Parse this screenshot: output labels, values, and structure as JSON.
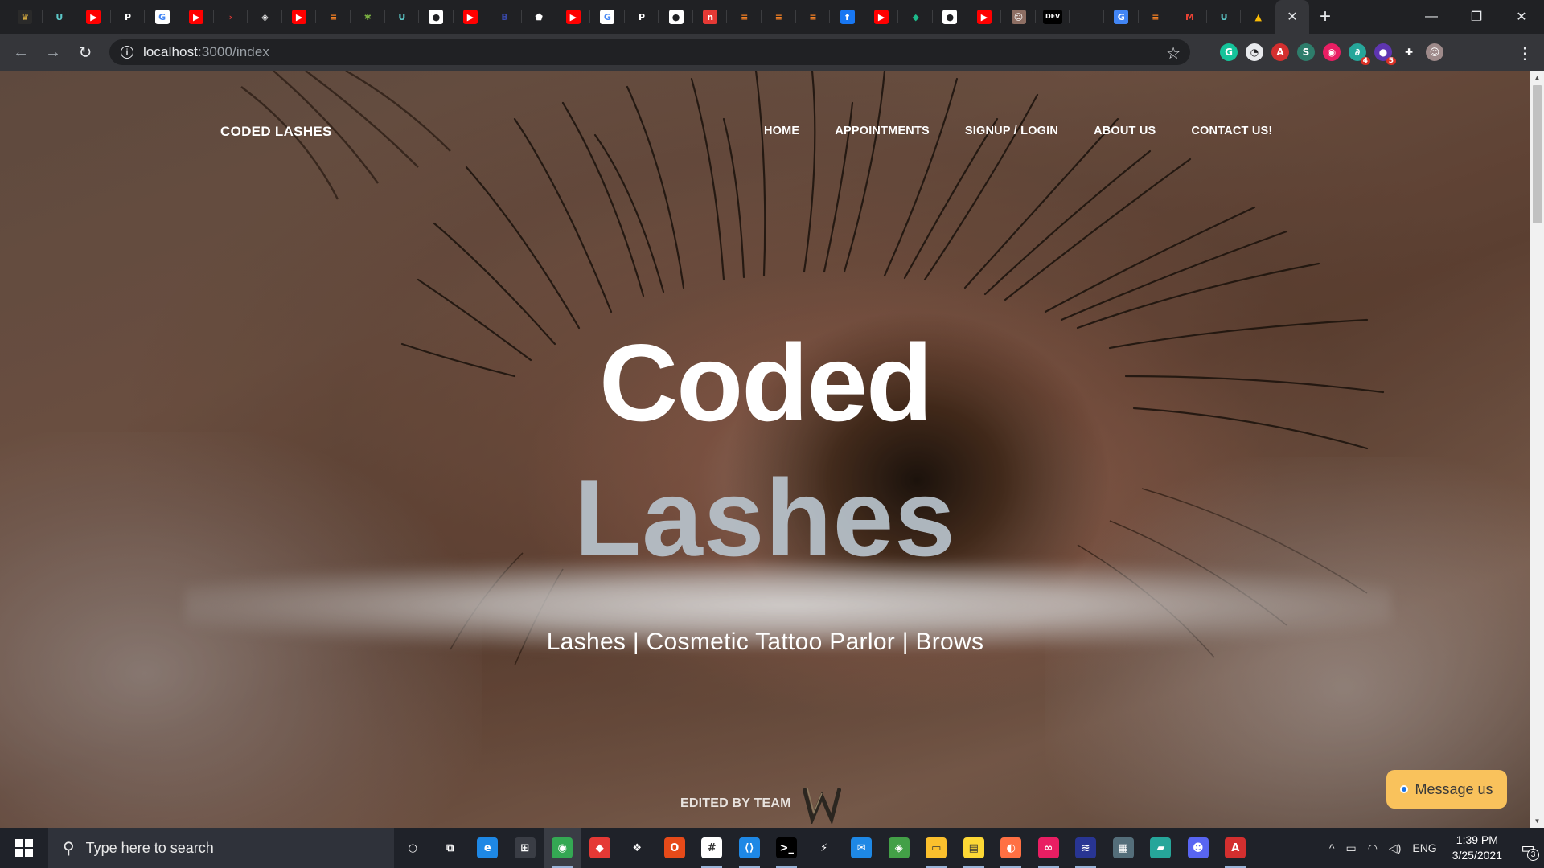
{
  "browser": {
    "tab_favicons": [
      {
        "name": "shield-icon",
        "bg": "#2a2a2a",
        "fg": "#e0b341",
        "glyph": "♛"
      },
      {
        "name": "udemy-icon",
        "bg": "#202124",
        "fg": "#5cc8c8",
        "glyph": "U"
      },
      {
        "name": "youtube-icon",
        "bg": "#ff0000",
        "fg": "#ffffff",
        "glyph": "▶"
      },
      {
        "name": "p-icon",
        "bg": "#202124",
        "fg": "#ffffff",
        "glyph": "P"
      },
      {
        "name": "google-icon",
        "bg": "#ffffff",
        "fg": "#4285f4",
        "glyph": "G"
      },
      {
        "name": "youtube-icon",
        "bg": "#ff0000",
        "fg": "#ffffff",
        "glyph": "▶"
      },
      {
        "name": "arrow-icon",
        "bg": "#202124",
        "fg": "#e53935",
        "glyph": "›"
      },
      {
        "name": "cube-icon",
        "bg": "#202124",
        "fg": "#ffffff",
        "glyph": "◈"
      },
      {
        "name": "youtube-icon",
        "bg": "#ff0000",
        "fg": "#ffffff",
        "glyph": "▶"
      },
      {
        "name": "stackoverflow-icon",
        "bg": "#202124",
        "fg": "#f48024",
        "glyph": "≡"
      },
      {
        "name": "spark-icon",
        "bg": "#202124",
        "fg": "#7cb342",
        "glyph": "✱"
      },
      {
        "name": "udemy-icon",
        "bg": "#202124",
        "fg": "#5cc8c8",
        "glyph": "U"
      },
      {
        "name": "github-icon",
        "bg": "#ffffff",
        "fg": "#202124",
        "glyph": "●"
      },
      {
        "name": "youtube-icon",
        "bg": "#ff0000",
        "fg": "#ffffff",
        "glyph": "▶"
      },
      {
        "name": "bootstrap-icon",
        "bg": "#202124",
        "fg": "#3949ab",
        "glyph": "B"
      },
      {
        "name": "pentagon-icon",
        "bg": "#202124",
        "fg": "#ffffff",
        "glyph": "⬟"
      },
      {
        "name": "youtube-icon",
        "bg": "#ff0000",
        "fg": "#ffffff",
        "glyph": "▶"
      },
      {
        "name": "google-icon",
        "bg": "#ffffff",
        "fg": "#4285f4",
        "glyph": "G"
      },
      {
        "name": "p-icon",
        "bg": "#202124",
        "fg": "#ffffff",
        "glyph": "P"
      },
      {
        "name": "github-icon",
        "bg": "#ffffff",
        "fg": "#202124",
        "glyph": "●"
      },
      {
        "name": "n-icon",
        "bg": "#e53935",
        "fg": "#ffffff",
        "glyph": "n"
      },
      {
        "name": "stackoverflow-icon",
        "bg": "#202124",
        "fg": "#f48024",
        "glyph": "≡"
      },
      {
        "name": "stackoverflow-icon",
        "bg": "#202124",
        "fg": "#f48024",
        "glyph": "≡"
      },
      {
        "name": "stackoverflow-icon",
        "bg": "#202124",
        "fg": "#f48024",
        "glyph": "≡"
      },
      {
        "name": "facebook-icon",
        "bg": "#1877f2",
        "fg": "#ffffff",
        "glyph": "f"
      },
      {
        "name": "youtube-icon",
        "bg": "#ff0000",
        "fg": "#ffffff",
        "glyph": "▶"
      },
      {
        "name": "diamond-icon",
        "bg": "#202124",
        "fg": "#1db98a",
        "glyph": "◆"
      },
      {
        "name": "github-icon",
        "bg": "#ffffff",
        "fg": "#202124",
        "glyph": "●"
      },
      {
        "name": "youtube-icon",
        "bg": "#ff0000",
        "fg": "#ffffff",
        "glyph": "▶"
      },
      {
        "name": "avatar-icon",
        "bg": "#8d6e63",
        "fg": "#ffffff",
        "glyph": "☺"
      },
      {
        "name": "dev-icon",
        "bg": "#000000",
        "fg": "#ffffff",
        "glyph": "DEV"
      },
      {
        "name": "blank-icon",
        "bg": "#202124",
        "fg": "#202124",
        "glyph": ""
      },
      {
        "name": "translate-icon",
        "bg": "#4285f4",
        "fg": "#ffffff",
        "glyph": "G"
      },
      {
        "name": "stackoverflow-icon",
        "bg": "#202124",
        "fg": "#f48024",
        "glyph": "≡"
      },
      {
        "name": "gmail-icon",
        "bg": "#202124",
        "fg": "#ea4335",
        "glyph": "M"
      },
      {
        "name": "udemy-icon",
        "bg": "#202124",
        "fg": "#5cc8c8",
        "glyph": "U"
      },
      {
        "name": "drive-icon",
        "bg": "#202124",
        "fg": "#fbbc04",
        "glyph": "▲"
      }
    ],
    "active_tab_close": "✕",
    "new_tab": "+",
    "window_controls": {
      "minimize": "—",
      "restore": "❐",
      "close": "✕"
    },
    "nav": {
      "back": "←",
      "forward": "→",
      "reload": "↻"
    },
    "url_host": "localhost",
    "url_path": ":3000/index",
    "extensions": [
      {
        "name": "grammarly-icon",
        "bg": "#15c39a",
        "glyph": "G",
        "badge": ""
      },
      {
        "name": "speedometer-icon",
        "bg": "#e8eaed",
        "glyph": "◔",
        "badge": ""
      },
      {
        "name": "acrobat-icon",
        "bg": "#d32f2f",
        "glyph": "A",
        "badge": ""
      },
      {
        "name": "s-extension-icon",
        "bg": "#2e7d6b",
        "glyph": "S",
        "badge": ""
      },
      {
        "name": "pink-extension-icon",
        "bg": "#e91e63",
        "glyph": "◉",
        "badge": ""
      },
      {
        "name": "wakatime-icon",
        "bg": "#26a69a",
        "glyph": "∂",
        "badge": "4"
      },
      {
        "name": "purple-extension-icon",
        "bg": "#5e35b1",
        "glyph": "●",
        "badge": "5"
      },
      {
        "name": "puzzle-icon",
        "bg": "#35363a",
        "glyph": "✚",
        "badge": ""
      },
      {
        "name": "profile-avatar-icon",
        "bg": "#9e8a8a",
        "glyph": "☺",
        "badge": ""
      }
    ]
  },
  "site": {
    "brand": "CODED LASHES",
    "nav_links": [
      "HOME",
      "APPOINTMENTS",
      "SIGNUP / LOGIN",
      "ABOUT US",
      "CONTACT US!"
    ],
    "title_line1": "Coded",
    "title_line2": "Lashes",
    "tagline": "Lashes | Cosmetic Tattoo Parlor | Brows",
    "credit": "EDITED BY TEAM",
    "message_button": "Message us"
  },
  "taskbar": {
    "search_placeholder": "Type here to search",
    "apps": [
      {
        "name": "cortana-icon",
        "bg": "transparent",
        "glyph": "○",
        "running": false,
        "active": false
      },
      {
        "name": "task-view-icon",
        "bg": "transparent",
        "glyph": "⧉",
        "running": false,
        "active": false
      },
      {
        "name": "edge-icon",
        "bg": "#1e88e5",
        "glyph": "e",
        "running": false,
        "active": false
      },
      {
        "name": "store-icon",
        "bg": "#3a3d45",
        "glyph": "⊞",
        "running": false,
        "active": false
      },
      {
        "name": "chrome-icon",
        "bg": "#34a853",
        "glyph": "◉",
        "running": true,
        "active": true
      },
      {
        "name": "git-kraken-icon",
        "bg": "#e53935",
        "glyph": "◆",
        "running": false,
        "active": false
      },
      {
        "name": "dropbox-icon",
        "bg": "transparent",
        "glyph": "❖",
        "running": false,
        "active": false
      },
      {
        "name": "office-icon",
        "bg": "#e64a19",
        "glyph": "O",
        "running": false,
        "active": false
      },
      {
        "name": "slack-icon",
        "bg": "#ffffff",
        "glyph": "#",
        "running": true,
        "active": false
      },
      {
        "name": "vscode-icon",
        "bg": "#1e88e5",
        "glyph": "⟨⟩",
        "running": true,
        "active": false
      },
      {
        "name": "terminal-icon",
        "bg": "#000000",
        "glyph": ">_",
        "running": true,
        "active": false
      },
      {
        "name": "bolt-icon",
        "bg": "transparent",
        "glyph": "⚡",
        "running": false,
        "active": false
      },
      {
        "name": "mail-icon",
        "bg": "#1e88e5",
        "glyph": "✉",
        "running": false,
        "active": false
      },
      {
        "name": "git-icon",
        "bg": "#43a047",
        "glyph": "◈",
        "running": false,
        "active": false
      },
      {
        "name": "folder-icon",
        "bg": "#fbc02d",
        "glyph": "▭",
        "running": true,
        "active": false
      },
      {
        "name": "sticky-notes-icon",
        "bg": "#fdd835",
        "glyph": "▤",
        "running": true,
        "active": false
      },
      {
        "name": "compass-icon",
        "bg": "#ff7043",
        "glyph": "◐",
        "running": true,
        "active": false
      },
      {
        "name": "creative-cloud-icon",
        "bg": "#e91e63",
        "glyph": "∞",
        "running": true,
        "active": false
      },
      {
        "name": "code-editor-icon",
        "bg": "#283593",
        "glyph": "≋",
        "running": true,
        "active": false
      },
      {
        "name": "calculator-icon",
        "bg": "#546e7a",
        "glyph": "▦",
        "running": false,
        "active": false
      },
      {
        "name": "notes-icon",
        "bg": "#26a69a",
        "glyph": "▰",
        "running": false,
        "active": false
      },
      {
        "name": "discord-icon",
        "bg": "#5865f2",
        "glyph": "☻",
        "running": false,
        "active": false
      },
      {
        "name": "acrobat-icon",
        "bg": "#d32f2f",
        "glyph": "A",
        "running": true,
        "active": false
      }
    ],
    "tray": {
      "chevron": "^",
      "battery": "▭",
      "wifi": "◠",
      "volume": "◁)",
      "language": "ENG",
      "time": "1:39 PM",
      "date": "3/25/2021",
      "notifications": "3"
    }
  }
}
